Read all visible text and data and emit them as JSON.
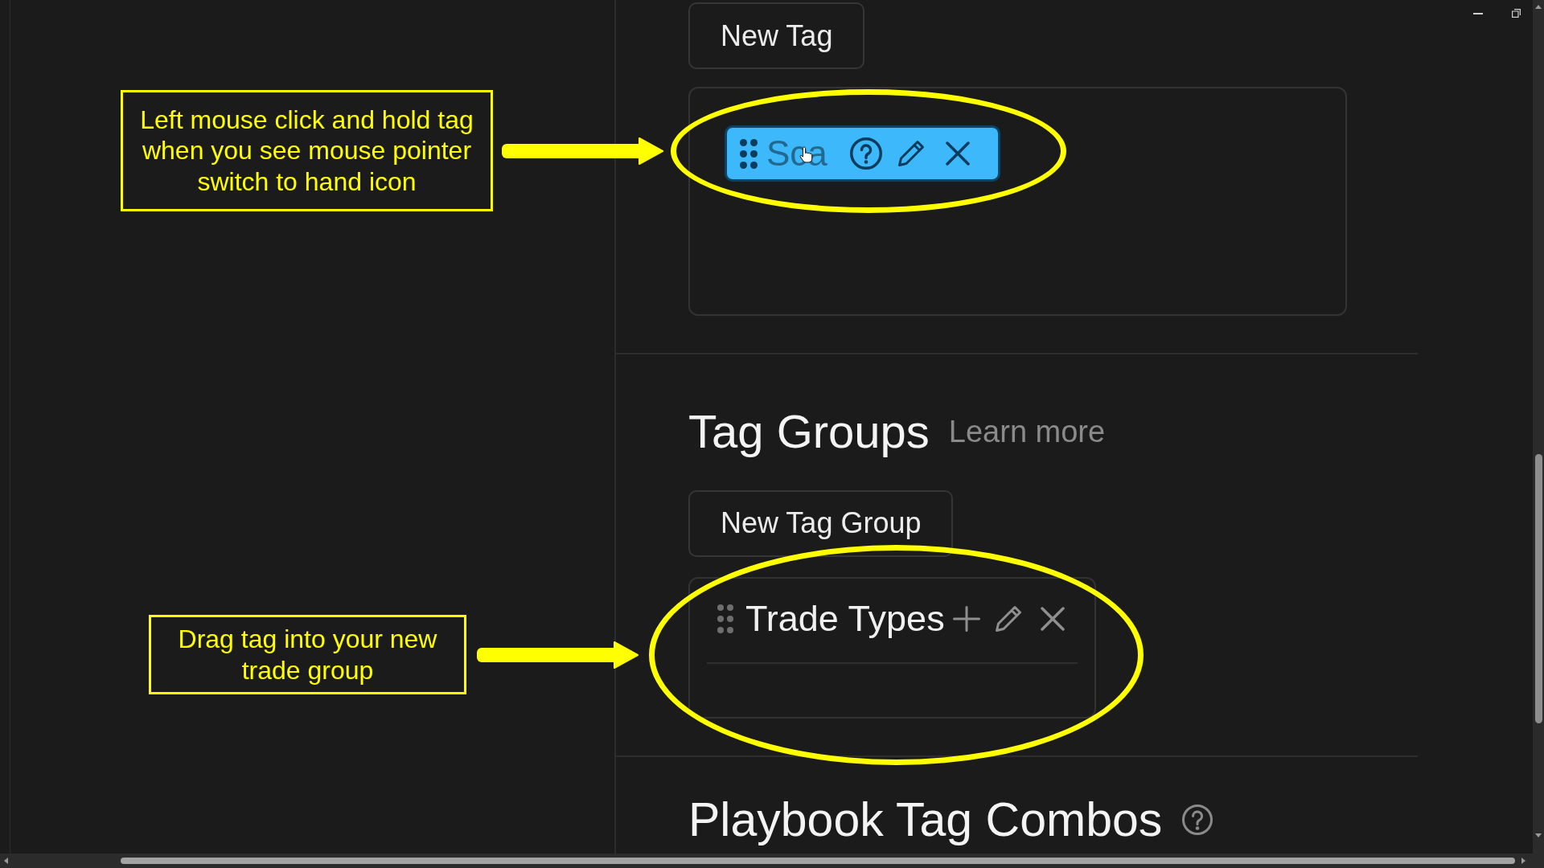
{
  "tags_section": {
    "new_tag_button": "New Tag",
    "tags": [
      {
        "label": "Sca",
        "color": "#3db8fa",
        "grabbed": true
      }
    ],
    "callout": "Left mouse click and hold tag when you see mouse pointer switch to hand icon"
  },
  "tag_groups_section": {
    "title": "Tag Groups",
    "learn_more_link": "Learn more",
    "new_group_button": "New Tag Group",
    "groups": [
      {
        "name": "Trade Types"
      }
    ],
    "callout": "Drag tag into your new trade group"
  },
  "playbook_section": {
    "title": "Playbook Tag Combos"
  }
}
